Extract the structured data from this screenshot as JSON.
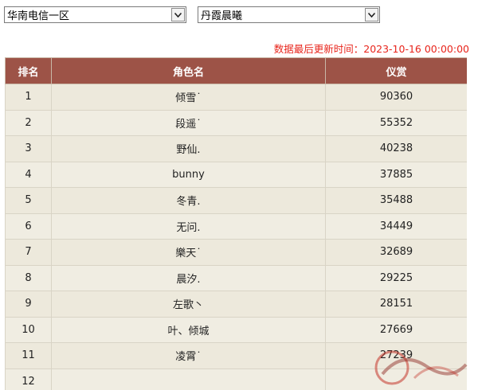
{
  "server_select": {
    "value": "华南电信一区"
  },
  "realm_select": {
    "value": "丹霞晨曦"
  },
  "update_time": "数据最后更新时间：2023-10-16 00:00:00",
  "table": {
    "headers": [
      "排名",
      "角色名",
      "仪赏"
    ],
    "rows": [
      [
        "1",
        "倾雪˙",
        "90360"
      ],
      [
        "2",
        "段遥˙",
        "55352"
      ],
      [
        "3",
        "野仙.",
        "40238"
      ],
      [
        "4",
        "bunny",
        "37885"
      ],
      [
        "5",
        "冬青.",
        "35488"
      ],
      [
        "6",
        "无问.",
        "34449"
      ],
      [
        "7",
        "樂天˙",
        "32689"
      ],
      [
        "8",
        "晨汐.",
        "29225"
      ],
      [
        "9",
        "左歌丶",
        "28151"
      ],
      [
        "10",
        "叶、倾城",
        "27669"
      ],
      [
        "11",
        "凌霄˙",
        "27239"
      ],
      [
        "12",
        "",
        ""
      ]
    ]
  },
  "watermark": {
    "text": "天涯明月刀",
    "url_text": "TLABAGYOU.COM"
  },
  "colors": {
    "header_bg": "#9d5347",
    "row_bg": "#ede9dc",
    "update_text": "#e8241b"
  }
}
